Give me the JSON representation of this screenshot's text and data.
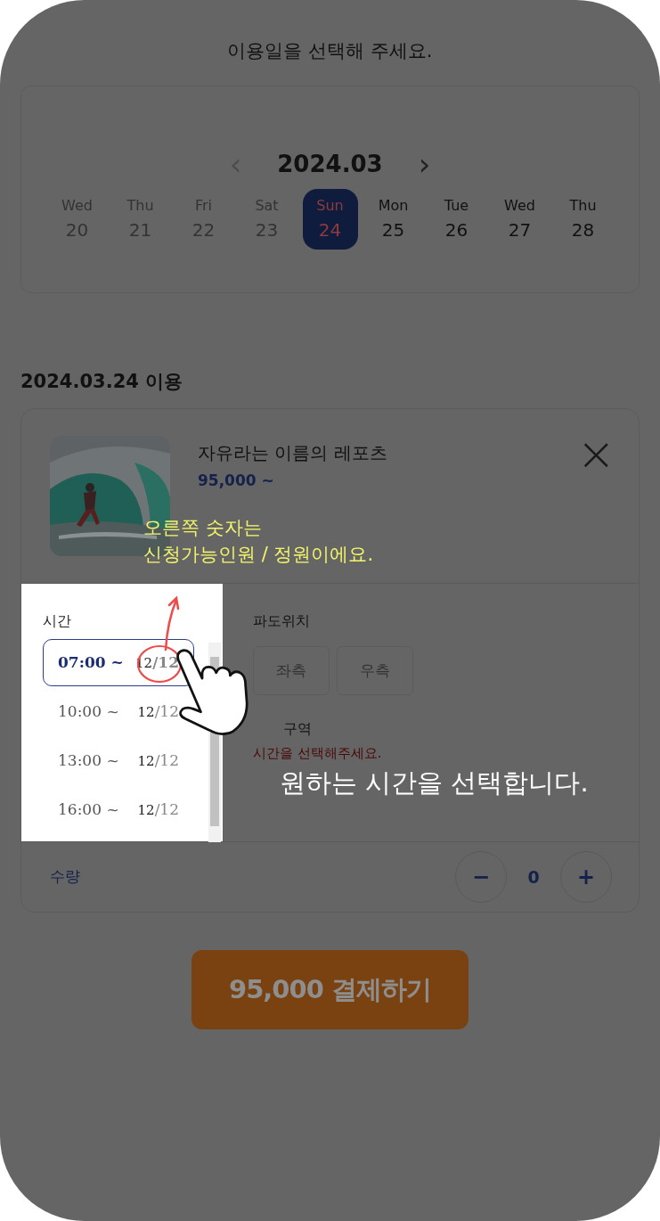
{
  "heading": "이용일을 선택해 주세요.",
  "calendar": {
    "month": "2024.03",
    "prev": "‹",
    "next": "›",
    "days": [
      {
        "weekday": "Wed",
        "date": "20",
        "disabled": true,
        "selected": false
      },
      {
        "weekday": "Thu",
        "date": "21",
        "disabled": true,
        "selected": false
      },
      {
        "weekday": "Fri",
        "date": "22",
        "disabled": true,
        "selected": false
      },
      {
        "weekday": "Sat",
        "date": "23",
        "disabled": true,
        "selected": false
      },
      {
        "weekday": "Sun",
        "date": "24",
        "disabled": false,
        "selected": true
      },
      {
        "weekday": "Mon",
        "date": "25",
        "disabled": false,
        "selected": false
      },
      {
        "weekday": "Tue",
        "date": "26",
        "disabled": false,
        "selected": false
      },
      {
        "weekday": "Wed",
        "date": "27",
        "disabled": false,
        "selected": false
      },
      {
        "weekday": "Thu",
        "date": "28",
        "disabled": false,
        "selected": false
      }
    ]
  },
  "date_heading": "2024.03.24 이용",
  "product": {
    "title": "자유라는 이름의 레포츠",
    "price": "95,000 ~",
    "close": "×"
  },
  "time": {
    "label": "시간",
    "slots": [
      {
        "time": "07:00 ~",
        "count": "12",
        "capacity": "/12",
        "selected": true
      },
      {
        "time": "10:00 ~",
        "count": "12",
        "capacity": "/12",
        "selected": false
      },
      {
        "time": "13:00 ~",
        "count": "12",
        "capacity": "/12",
        "selected": false
      },
      {
        "time": "16:00 ~",
        "count": "12",
        "capacity": "/12",
        "selected": false
      }
    ]
  },
  "wave_position": {
    "label": "파도위치",
    "options": [
      {
        "label": "좌측",
        "selected": false
      },
      {
        "label": "우측",
        "selected": false
      }
    ]
  },
  "zone": {
    "label": "구역",
    "message": "시간을 선택해주세요."
  },
  "quantity": {
    "label": "수량",
    "minus": "−",
    "value": "0",
    "plus": "+"
  },
  "pay_button": "95,000 결제하기",
  "hints": {
    "lines": [
      "오른쪽 숫자는",
      "신청가능인원 / 정원이에요."
    ],
    "tap": "원하는 시간을 선택합니다."
  }
}
